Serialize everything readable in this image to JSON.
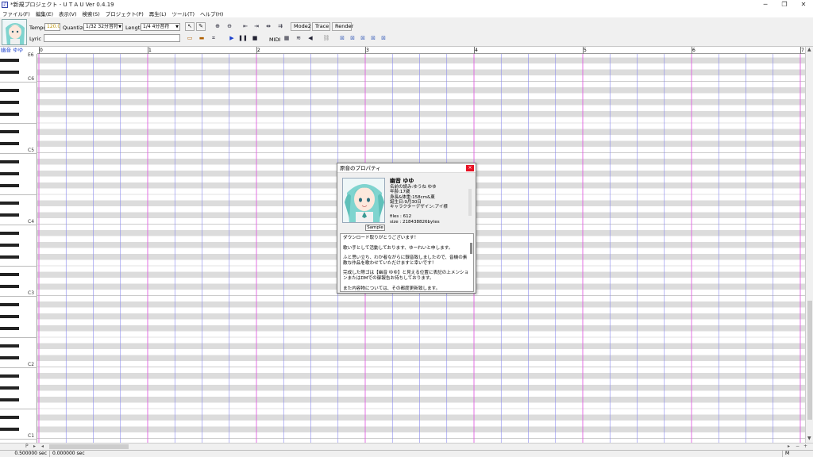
{
  "window": {
    "title": "*新規プロジェクト - U T A U Ver 0.4.19",
    "controls": [
      "─",
      "❐",
      "✕"
    ]
  },
  "menu": [
    "ファイル(F)",
    "編集(E)",
    "表示(V)",
    "検索(S)",
    "プロジェクト(P)",
    "再生(L)",
    "ツール(T)",
    "ヘルプ(H)"
  ],
  "toolbar": {
    "tempo_label": "Tempo",
    "tempo_value": "120.0",
    "quantize_label": "Quantize",
    "quantize_value": "1/32 32分音符",
    "length_label": "Length",
    "length_value": "1/4 4分音符",
    "lyric_label": "Lyric",
    "lyric_value": "",
    "mode2_label": "Mode2",
    "trace_label": "Trace",
    "render_label": "Render",
    "midi_label": "MIDI"
  },
  "singer": {
    "name": "幽音 ゆゆ"
  },
  "ruler": {
    "measures": [
      "0",
      "1",
      "2",
      "3",
      "4",
      "5",
      "6",
      "7"
    ]
  },
  "piano": {
    "octave_labels": [
      "E6",
      "C6",
      "C5",
      "C4",
      "C3",
      "C2",
      "C1"
    ]
  },
  "statusbar": {
    "time1": "0.500000 sec",
    "time2": "0.000000 sec",
    "mode": "M"
  },
  "dialog": {
    "title": "原音のプロパティ",
    "close": "×",
    "singer_name": "幽音 ゆゆ",
    "info_lines": [
      "名前の読み:ゆうね ゆゆ",
      "年齢:17歳",
      "身長&体重:158cm&東",
      "誕生日:9月30日",
      "キャラクターデザイン:アイ様"
    ],
    "files": "files : 612",
    "size": "size : 218438826bytes",
    "sample_button": "Sample",
    "readme": [
      "ダウンロード取りがとうございます！",
      "歌い手として活動しております、ゆーれいと申します。",
      "ふと思い立ち、わか者ながらに録音致しましたので、音機の素敵な作品を歌わせていただけますと幸いです！",
      "完成した際ゴは【幽音 ゆゆ】と見える位置に表記の上メンションまたはDMでの御報告お待ちしております。",
      "また内容物については、その都度更新致します。"
    ]
  },
  "colors": {
    "measure_line": "#e060e0",
    "beat_line": "#8888ee",
    "black_key_row": "#dcdcdc",
    "singer_name": "#1a3fcc"
  }
}
